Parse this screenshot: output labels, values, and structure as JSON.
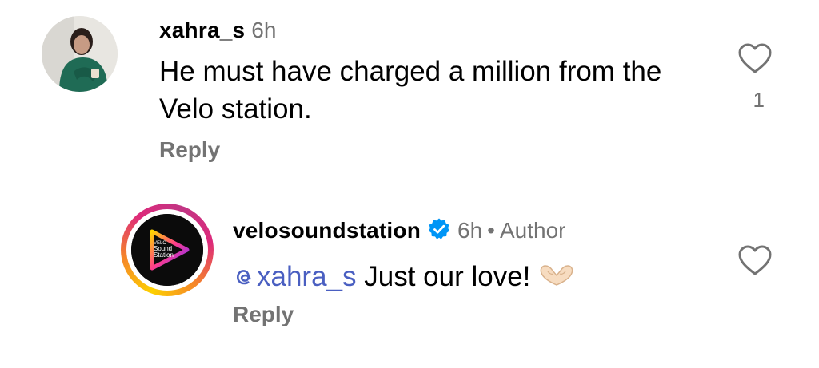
{
  "comments": [
    {
      "username": "xahra_s",
      "time": "6h",
      "text": "He must have charged a million from the Velo station.",
      "reply_label": "Reply",
      "like_count": "1",
      "avatar_icon": "user-photo-avatar",
      "like_icon": "heart-outline-icon"
    },
    {
      "username": "velosoundstation",
      "verified": true,
      "time": "6h",
      "separator": "•",
      "author_label": "Author",
      "mention": "xahra_s",
      "mention_prefix_icon": "threads-at-icon",
      "text": " Just our love!",
      "emoji_icon": "heart-hands-emoji",
      "reply_label": "Reply",
      "avatar_logo_lines": [
        "VELO",
        "Sound",
        "Station"
      ],
      "like_icon": "heart-outline-icon"
    }
  ],
  "colors": {
    "secondary_text": "#737373",
    "mention": "#4a5fc1",
    "verified_badge": "#0095f6"
  }
}
